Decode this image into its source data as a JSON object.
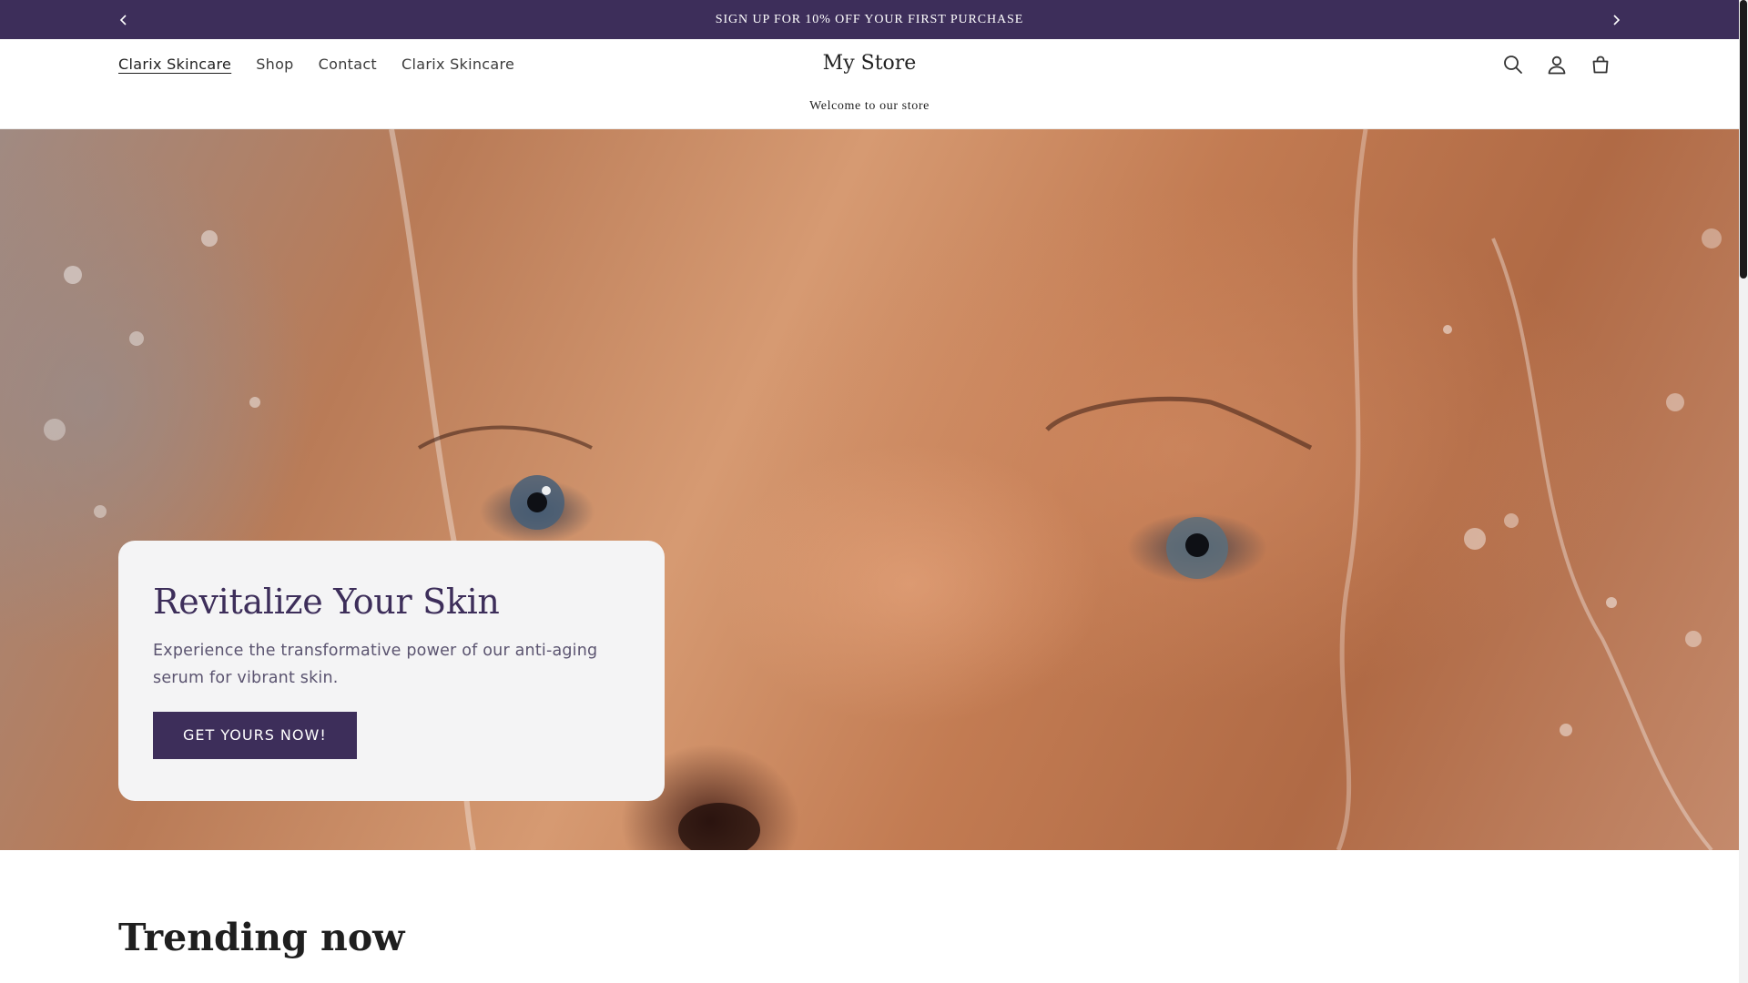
{
  "announcement": {
    "text": "SIGN UP FOR 10% OFF YOUR FIRST PURCHASE",
    "prev_icon": "chevron-left-icon",
    "next_icon": "chevron-right-icon"
  },
  "header": {
    "nav": [
      {
        "label": "Clarix Skincare",
        "active": true
      },
      {
        "label": "Shop",
        "active": false
      },
      {
        "label": "Contact",
        "active": false
      },
      {
        "label": "Clarix Skincare",
        "active": false
      }
    ],
    "store_title": "My Store",
    "tagline": "Welcome to our store",
    "icons": [
      "search-icon",
      "account-icon",
      "cart-icon"
    ]
  },
  "hero": {
    "heading": "Revitalize Your Skin",
    "subheading": "Experience the transformative power of our anti-aging serum for vibrant skin.",
    "cta_label": "GET YOURS NOW!"
  },
  "trending": {
    "heading": "Trending now"
  },
  "colors": {
    "brand": "#3d2e5a",
    "card_bg": "#f4f4f5",
    "subtext": "#5b5470"
  }
}
